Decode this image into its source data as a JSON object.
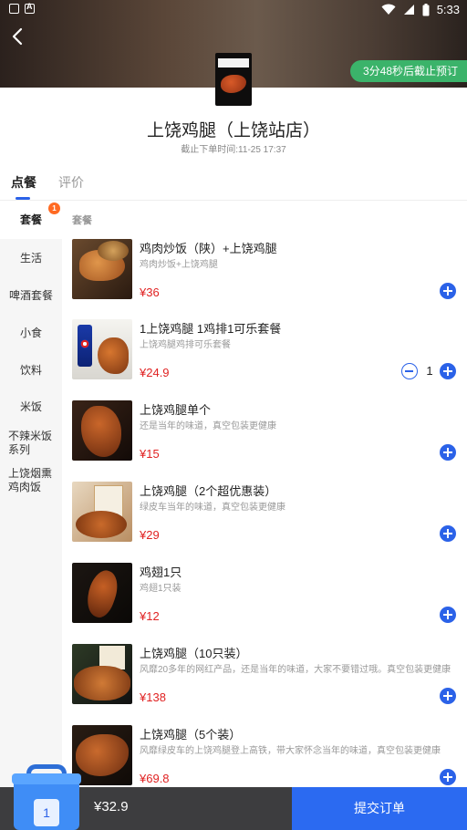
{
  "status_bar": {
    "time": "5:33"
  },
  "header": {
    "countdown_text": "3分48秒后截止预订",
    "shop_name": "上饶鸡腿（上饶站店）",
    "deadline_text": "截止下单时间:11-25 17:37"
  },
  "tabs": [
    {
      "label": "点餐",
      "active": true
    },
    {
      "label": "评价",
      "active": false
    }
  ],
  "sidebar": {
    "badge": "1",
    "items": [
      {
        "label": "套餐",
        "active": true
      },
      {
        "label": "生活"
      },
      {
        "label": "啤酒套餐"
      },
      {
        "label": "小食"
      },
      {
        "label": "饮料"
      },
      {
        "label": "米饭"
      },
      {
        "label": "不辣米饭系列"
      },
      {
        "label": "上饶烟熏鸡肉饭"
      }
    ]
  },
  "section_title": "套餐",
  "products": [
    {
      "name": "鸡肉炒饭（陕）+上饶鸡腿",
      "desc": "鸡肉炒饭+上饶鸡腿",
      "price": "¥36"
    },
    {
      "name": "1上饶鸡腿 1鸡排1可乐套餐",
      "desc": "上饶鸡腿鸡排可乐套餐",
      "price": "¥24.9",
      "quantity": "1"
    },
    {
      "name": "上饶鸡腿单个",
      "desc": "还是当年的味道，真空包装更健康",
      "price": "¥15"
    },
    {
      "name": "上饶鸡腿（2个超优惠装）",
      "desc": "绿皮车当年的味道，真空包装更健康",
      "price": "¥29"
    },
    {
      "name": "鸡翅1只",
      "desc": "鸡翅1只装",
      "price": "¥12"
    },
    {
      "name": "上饶鸡腿（10只装）",
      "desc": "风靡20多年的网红产品，还是当年的味道，大家不要错过哦。真空包装更健康",
      "price": "¥138"
    },
    {
      "name": "上饶鸡腿（5个装）",
      "desc": "风靡绿皮车的上饶鸡腿登上高铁，带大家怀念当年的味道，真空包装更健康",
      "price": "¥69.8"
    }
  ],
  "cart": {
    "count": "1",
    "total": "¥32.9",
    "checkout_label": "提交订单"
  },
  "colors": {
    "accent": "#2b62e8",
    "price": "#e02222",
    "countdown_bg": "#3bb36a",
    "cart_bar": "#3d3d3f"
  }
}
